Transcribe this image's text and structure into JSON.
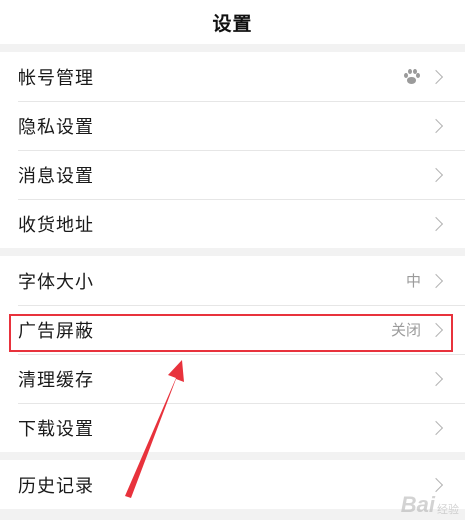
{
  "header": {
    "title": "设置"
  },
  "groups": [
    {
      "items": [
        {
          "label": "帐号管理",
          "value": "",
          "icon": "paw-icon"
        },
        {
          "label": "隐私设置",
          "value": ""
        },
        {
          "label": "消息设置",
          "value": ""
        },
        {
          "label": "收货地址",
          "value": ""
        }
      ]
    },
    {
      "items": [
        {
          "label": "字体大小",
          "value": "中"
        },
        {
          "label": "广告屏蔽",
          "value": "关闭"
        },
        {
          "label": "清理缓存",
          "value": ""
        },
        {
          "label": "下载设置",
          "value": ""
        }
      ]
    },
    {
      "items": [
        {
          "label": "历史记录",
          "value": ""
        }
      ]
    }
  ],
  "annotation": {
    "highlight_color": "#e8323c"
  },
  "watermark": {
    "text": "Bai",
    "sub": "经验"
  }
}
